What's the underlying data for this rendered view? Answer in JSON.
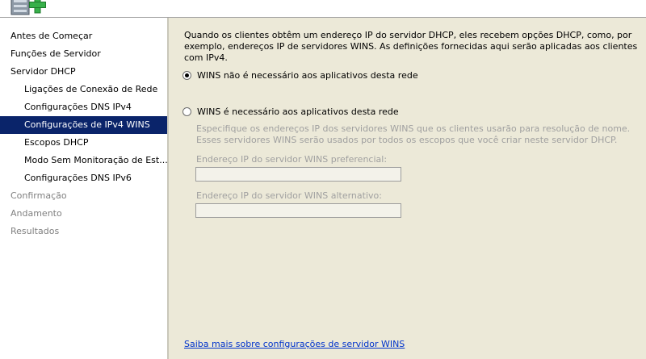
{
  "header": {
    "icon": "server-add-icon"
  },
  "nav": {
    "items": [
      {
        "label": "Antes de Começar",
        "state": "normal"
      },
      {
        "label": "Funções de Servidor",
        "state": "normal"
      },
      {
        "label": "Servidor DHCP",
        "state": "normal"
      },
      {
        "label": "Ligações de Conexão de Rede",
        "state": "normal"
      },
      {
        "label": "Configurações DNS IPv4",
        "state": "normal"
      },
      {
        "label": "Configurações de IPv4 WINS",
        "state": "selected"
      },
      {
        "label": "Escopos DHCP",
        "state": "normal"
      },
      {
        "label": "Modo Sem Monitoração de Est...",
        "state": "normal"
      },
      {
        "label": "Configurações DNS IPv6",
        "state": "normal"
      },
      {
        "label": "Confirmação",
        "state": "disabled"
      },
      {
        "label": "Andamento",
        "state": "disabled"
      },
      {
        "label": "Resultados",
        "state": "disabled"
      }
    ]
  },
  "content": {
    "intro": "Quando os clientes obtêm um endereço IP do servidor DHCP, eles recebem opções DHCP, como, por exemplo, endereços IP de servidores WINS. As definições fornecidas aqui serão aplicadas aos clientes com IPv4.",
    "option_not_required": {
      "label": "WINS não é necessário aos aplicativos desta rede",
      "checked": true
    },
    "option_required": {
      "label": "WINS é necessário aos aplicativos desta rede",
      "checked": false
    },
    "description": "Especifique os endereços IP dos servidores WINS que os clientes usarão para resolução de nome. Esses servidores WINS serão usados por todos os escopos que você criar neste servidor DHCP.",
    "preferred_label": "Endereço IP do servidor WINS preferencial:",
    "preferred_value": "",
    "alternate_label": "Endereço IP do servidor WINS alternativo:",
    "alternate_value": "",
    "help_link": "Saiba mais sobre configurações de servidor WINS"
  },
  "colors": {
    "selection": "#0a246a",
    "content_bg": "#ece9d8",
    "link": "#0033cc",
    "disabled_text": "#a0a0a0"
  }
}
